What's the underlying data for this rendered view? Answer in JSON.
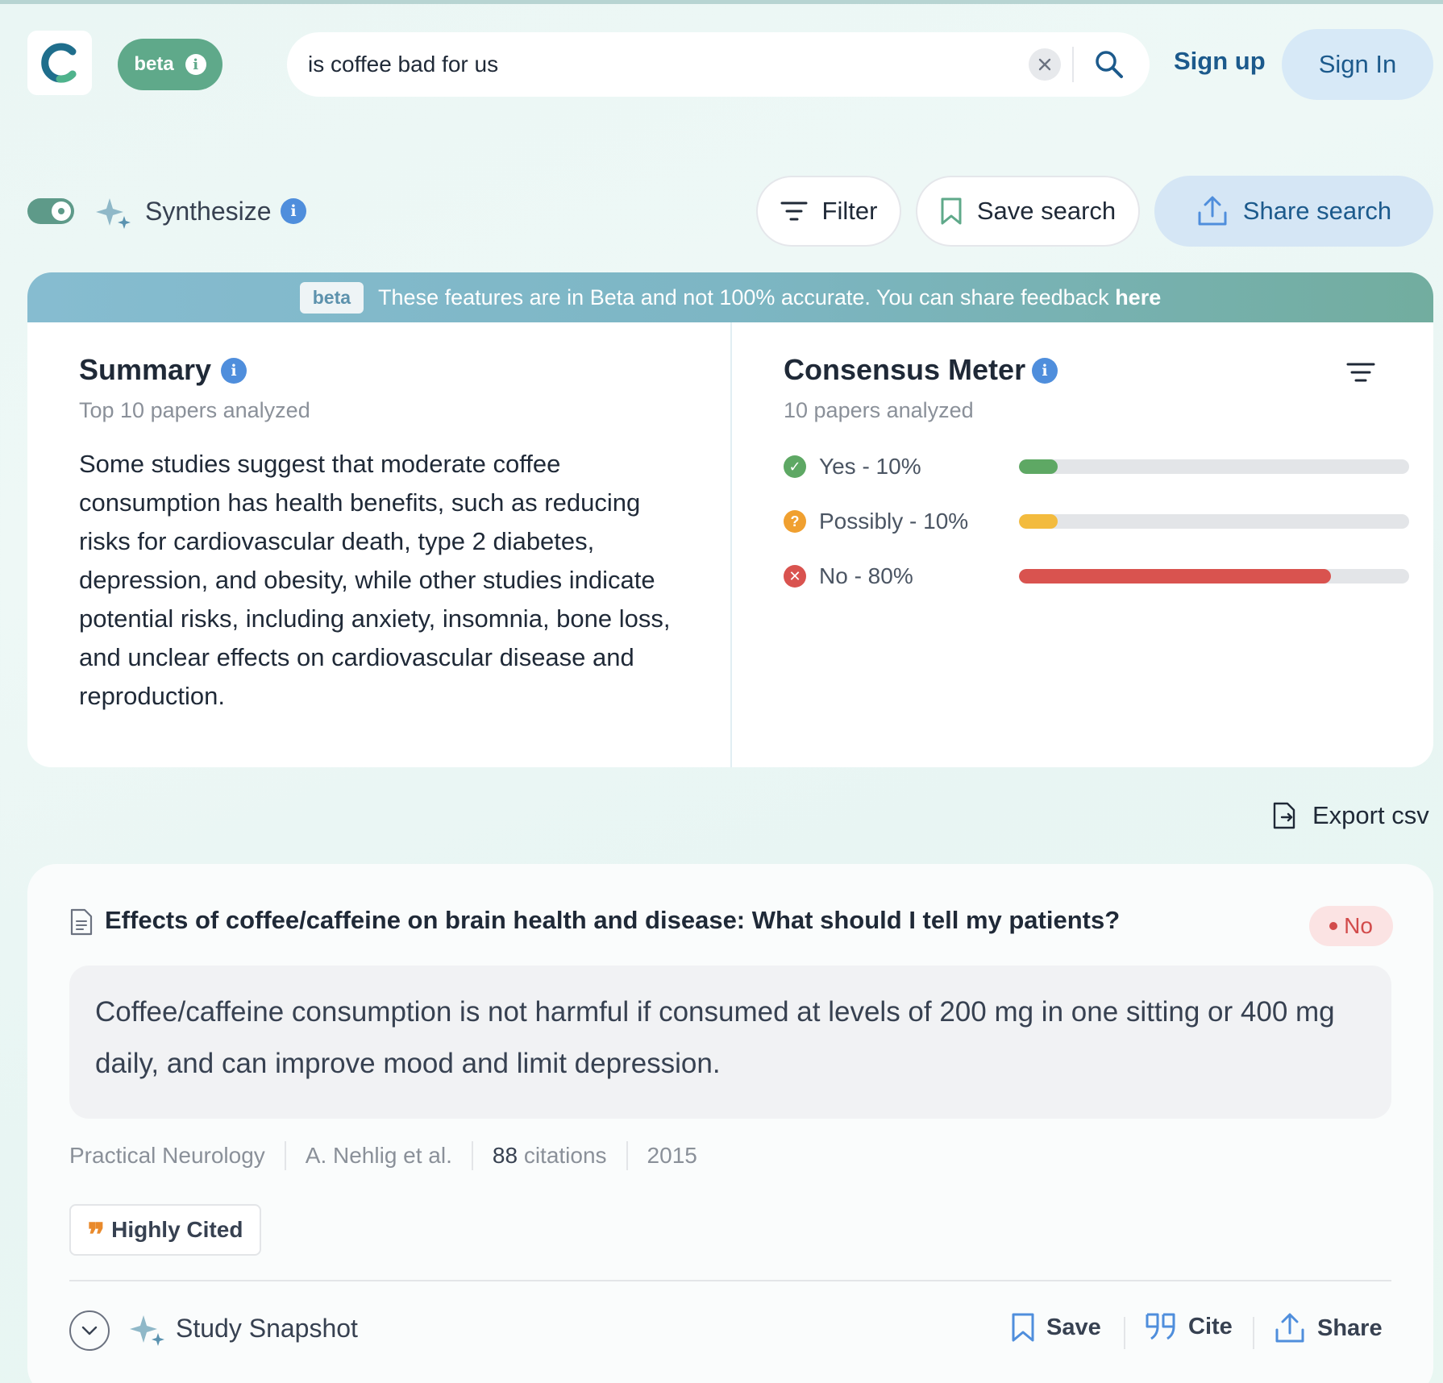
{
  "colors": {
    "brand_teal": "#5fa98a",
    "link_blue": "#1c5a8c",
    "info_blue": "#4f8edc",
    "yes_green": "#5ea864",
    "possibly_yellow": "#f3bb3e",
    "no_red": "#d9534f"
  },
  "header": {
    "beta_label": "beta",
    "search_value": "is coffee bad for us",
    "signup_label": "Sign up",
    "signin_label": "Sign In"
  },
  "toolbar": {
    "synthesize_label": "Synthesize",
    "synthesize_on": true,
    "filter_label": "Filter",
    "save_search_label": "Save search",
    "share_search_label": "Share search"
  },
  "banner": {
    "tag": "beta",
    "text": "These features are in Beta and not 100% accurate. You can share feedback",
    "link": "here"
  },
  "summary": {
    "title": "Summary",
    "subtitle": "Top 10 papers analyzed",
    "text": "Some studies suggest that moderate coffee consumption has health benefits, such as reducing risks for cardiovascular death, type 2 diabetes, depression, and obesity, while other studies indicate potential risks, including anxiety, insomnia, bone loss, and unclear effects on cardiovascular disease and reproduction."
  },
  "meter": {
    "title": "Consensus Meter",
    "subtitle": "10 papers analyzed",
    "rows": [
      {
        "label": "Yes - 10%",
        "percent": 10,
        "icon": "check-circle-icon"
      },
      {
        "label": "Possibly - 10%",
        "percent": 10,
        "icon": "question-circle-icon"
      },
      {
        "label": "No - 80%",
        "percent": 80,
        "icon": "x-circle-icon"
      }
    ]
  },
  "export_label": "Export csv",
  "result": {
    "title": "Effects of coffee/caffeine on brain health and disease: What should I tell my patients?",
    "verdict": "No",
    "claim": "Coffee/caffeine consumption is not harmful if consumed at levels of 200 mg in one sitting or 400 mg daily, and can improve mood and limit depression.",
    "journal": "Practical Neurology",
    "authors": "A. Nehlig et al.",
    "citations_count": "88",
    "citations_label": "citations",
    "year": "2015",
    "badge": "Highly Cited",
    "snapshot_label": "Study Snapshot",
    "save_label": "Save",
    "cite_label": "Cite",
    "share_label": "Share"
  }
}
